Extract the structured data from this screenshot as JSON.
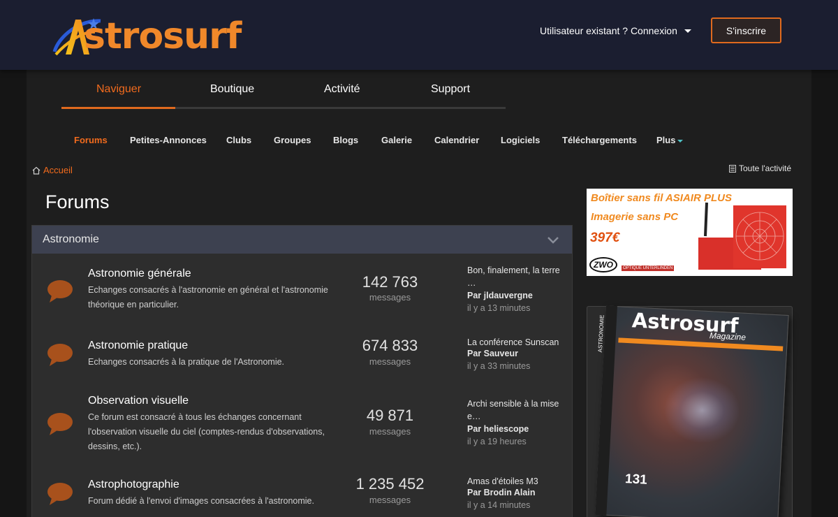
{
  "header": {
    "logo_text": "strosurf",
    "login_label": "Utilisateur existant ? Connexion",
    "signup_label": "S'inscrire"
  },
  "main_nav": {
    "items": [
      {
        "label": "Naviguer",
        "active": true
      },
      {
        "label": "Boutique"
      },
      {
        "label": "Activité"
      },
      {
        "label": "Support"
      }
    ]
  },
  "sub_nav": {
    "items": [
      {
        "label": "Forums",
        "active": true
      },
      {
        "label": "Petites-Annonces"
      },
      {
        "label": "Clubs"
      },
      {
        "label": "Groupes"
      },
      {
        "label": "Blogs"
      },
      {
        "label": "Galerie"
      },
      {
        "label": "Calendrier"
      },
      {
        "label": "Logiciels"
      },
      {
        "label": "Téléchargements"
      },
      {
        "label": "Plus"
      }
    ]
  },
  "breadcrumb": {
    "home": "Accueil"
  },
  "all_activity": "Toute l'activité",
  "page_title": "Forums",
  "category": {
    "title": "Astronomie",
    "forums": [
      {
        "title": "Astronomie générale",
        "description": "Echanges consacrés à l'astronomie en général et l'astronomie théorique en particulier.",
        "count": "142 763",
        "count_label": "messages",
        "last_title": "Bon, finalement, la terre …",
        "last_by": "Par jldauvergne",
        "last_time": "il y a 13 minutes"
      },
      {
        "title": "Astronomie pratique",
        "description": "Echanges consacrés à la pratique de l'Astronomie.",
        "count": "674 833",
        "count_label": "messages",
        "last_title": "La conférence Sunscan",
        "last_by": "Par Sauveur",
        "last_time": "il y a 33 minutes"
      },
      {
        "title": "Observation visuelle",
        "description": "Ce forum est consacré à tous les échanges concernant l'observation visuelle du ciel (comptes-rendus d'observations, dessins, etc.).",
        "count": "49 871",
        "count_label": "messages",
        "last_title": "Archi sensible à la mise e…",
        "last_by": "Par heliescope",
        "last_time": "il y a 19 heures"
      },
      {
        "title": "Astrophotographie",
        "description": "Forum dédié à l'envoi d'images consacrées à l'astronomie.",
        "count": "1 235 452",
        "count_label": "messages",
        "last_title": "Amas d'étoiles M3",
        "last_by": "Par Brodin Alain",
        "last_time": "il y a 14 minutes"
      }
    ]
  },
  "ad": {
    "line1": "Boîtier sans fil ASIAIR PLUS",
    "line2": "Imagerie sans PC",
    "price": "397€",
    "brand": "ZWO",
    "shop": "OPTIQUE UNTERLINDEN"
  },
  "magazine": {
    "title": "Astrosurf",
    "subtitle": "Magazine",
    "spine": "ASTRONOMIE",
    "issue": "131"
  },
  "colors": {
    "accent": "#f26b1d",
    "header_bg": "#1b1e30",
    "category_bg": "#3d4150",
    "bubble": "#a8511c"
  }
}
